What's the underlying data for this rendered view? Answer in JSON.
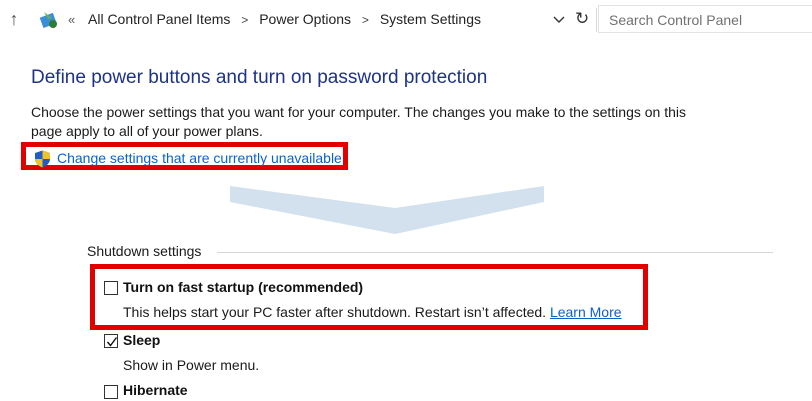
{
  "address_bar": {
    "breadcrumbs": [
      "All Control Panel Items",
      "Power Options",
      "System Settings"
    ],
    "search_placeholder": "Search Control Panel"
  },
  "main": {
    "title": "Define power buttons and turn on password protection",
    "description": "Choose the power settings that you want for your computer. The changes you make to the settings on this page apply to all of your power plans.",
    "change_settings_link": "Change settings that are currently unavailable"
  },
  "shutdown": {
    "group_label": "Shutdown settings",
    "options": [
      {
        "label": "Turn on fast startup (recommended)",
        "description": "This helps start your PC faster after shutdown. Restart isn’t affected.",
        "link": "Learn More",
        "checked": false
      },
      {
        "label": "Sleep",
        "description": "Show in Power menu.",
        "checked": true
      },
      {
        "label": "Hibernate",
        "checked": false
      }
    ]
  },
  "colors": {
    "highlight_border": "#e00000",
    "link": "#0a63c9",
    "title": "#1e3287"
  }
}
